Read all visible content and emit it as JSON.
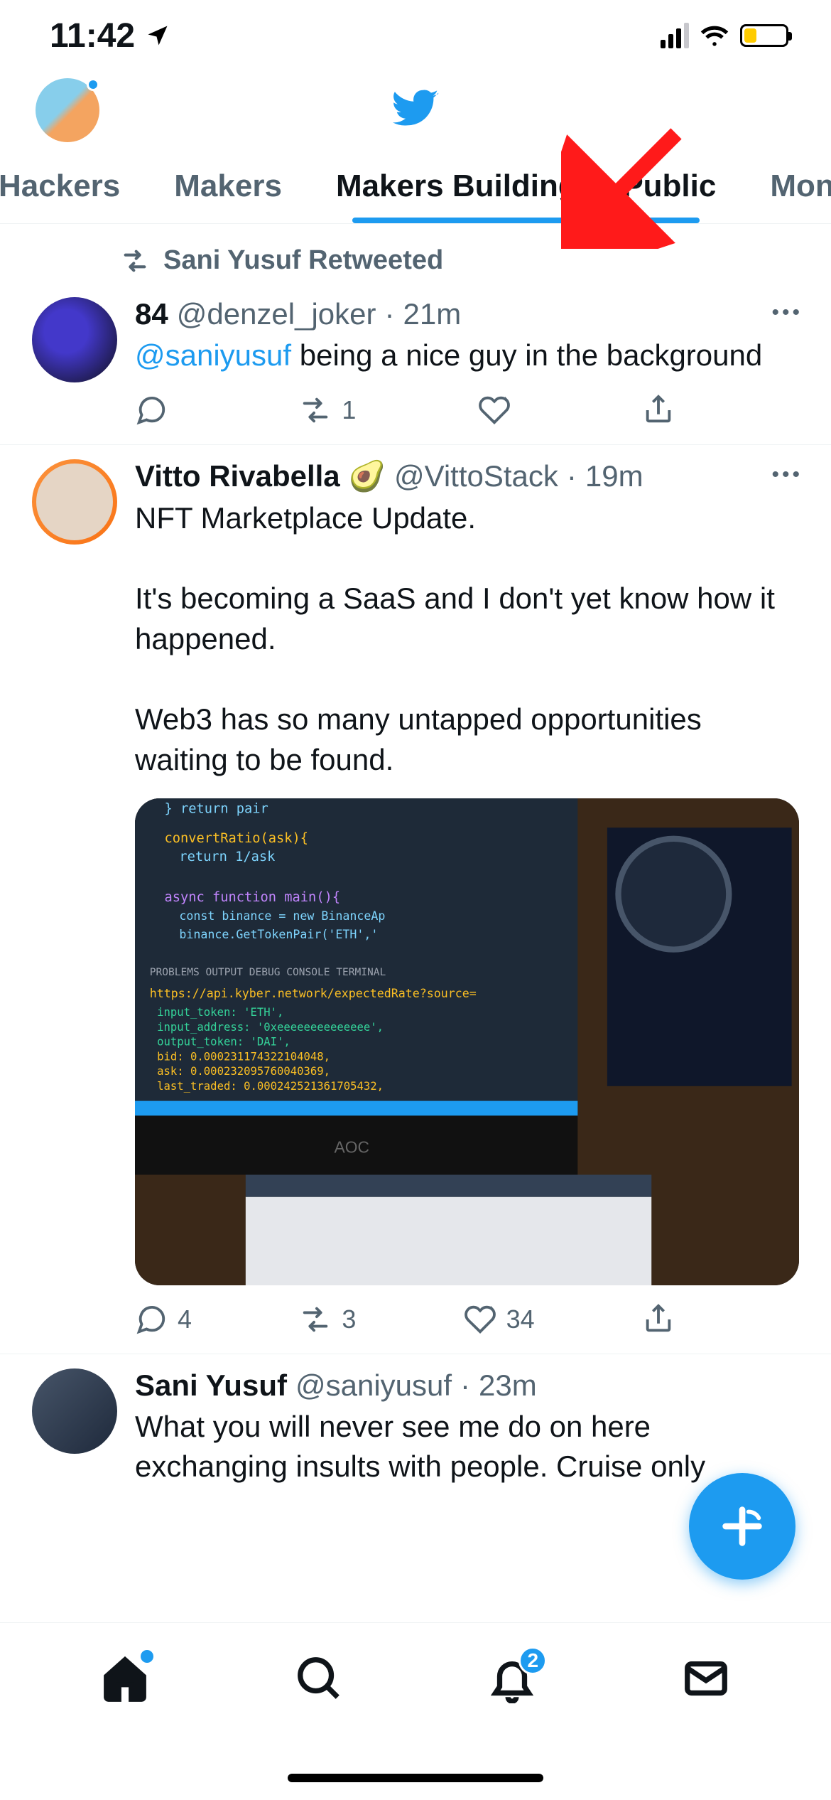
{
  "status": {
    "time": "11:42",
    "location_icon": "location-arrow"
  },
  "header": {
    "profile_has_badge": true
  },
  "tabs": [
    {
      "label": "Hackers",
      "active": false
    },
    {
      "label": "Makers",
      "active": false
    },
    {
      "label": "Makers Building in Public",
      "active": true
    },
    {
      "label": "Mone",
      "active": false
    }
  ],
  "annotation": {
    "type": "arrow",
    "color": "#ff0000"
  },
  "tweets": [
    {
      "social_context": "Sani Yusuf Retweeted",
      "display_name": "84",
      "handle": "@denzel_joker",
      "time": "21m",
      "text_pre_mention": "",
      "mention": "@saniyusuf",
      "text_post_mention": " being a nice guy in the background",
      "replies": "",
      "retweets": "1",
      "likes": ""
    },
    {
      "display_name": "Vitto Rivabella",
      "emoji": "🥑",
      "handle": "@VittoStack",
      "time": "19m",
      "text": "NFT Marketplace Update.\n\nIt's becoming a SaaS and I don't yet know how it happened.\n\nWeb3 has so many untapped opportunities waiting to be found.",
      "has_media": true,
      "replies": "4",
      "retweets": "3",
      "likes": "34"
    },
    {
      "display_name": "Sani Yusuf",
      "handle": "@saniyusuf",
      "time": "23m",
      "text": "What you will never see me do on here exchanging insults with people. Cruise only"
    }
  ],
  "nav": {
    "notifications_badge": "2"
  }
}
